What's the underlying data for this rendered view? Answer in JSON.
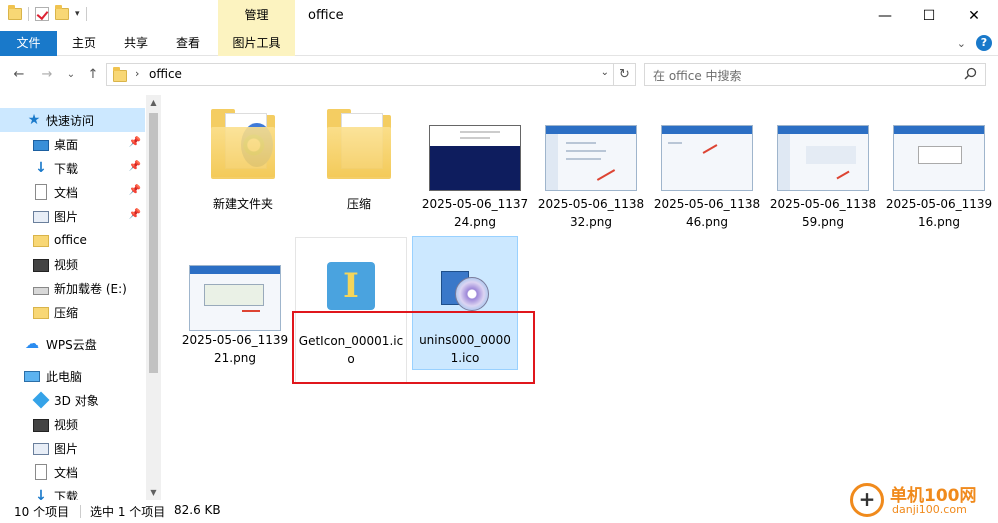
{
  "window": {
    "title": "office",
    "context_tab_group": "管理",
    "controls": [
      "—",
      "☐",
      "✕"
    ]
  },
  "ribbon": {
    "tabs": [
      "文件",
      "主页",
      "共享",
      "查看",
      "图片工具"
    ]
  },
  "address_bar": {
    "path": "office",
    "search_placeholder": "在 office 中搜索"
  },
  "nav_pane": {
    "items": [
      {
        "label": "快速访问",
        "icon": "star-icon"
      },
      {
        "label": "桌面",
        "icon": "desktop-icon"
      },
      {
        "label": "下载",
        "icon": "download-icon"
      },
      {
        "label": "文档",
        "icon": "document-icon"
      },
      {
        "label": "图片",
        "icon": "picture-icon"
      },
      {
        "label": "office",
        "icon": "folder-icon"
      },
      {
        "label": "视频",
        "icon": "video-icon"
      },
      {
        "label": "新加载卷 (E:)",
        "icon": "drive-icon"
      },
      {
        "label": "压缩",
        "icon": "folder-icon"
      },
      {
        "label": "WPS云盘",
        "icon": "cloud-icon"
      },
      {
        "label": "此电脑",
        "icon": "computer-icon"
      },
      {
        "label": "3D 对象",
        "icon": "3d-objects-icon"
      },
      {
        "label": "视频",
        "icon": "video-icon"
      },
      {
        "label": "图片",
        "icon": "picture-icon"
      },
      {
        "label": "文档",
        "icon": "document-icon"
      },
      {
        "label": "下载",
        "icon": "download-icon"
      }
    ]
  },
  "files": [
    {
      "name": "新建文件夹",
      "type": "folder"
    },
    {
      "name": "压缩",
      "type": "folder"
    },
    {
      "name": "2025-05-06_113724.png",
      "type": "image"
    },
    {
      "name": "2025-05-06_113832.png",
      "type": "image"
    },
    {
      "name": "2025-05-06_113846.png",
      "type": "image"
    },
    {
      "name": "2025-05-06_113859.png",
      "type": "image"
    },
    {
      "name": "2025-05-06_113916.png",
      "type": "image"
    },
    {
      "name": "2025-05-06_113921.png",
      "type": "image"
    },
    {
      "name": "GetIcon_00001.ico",
      "type": "ico"
    },
    {
      "name": "unins000_00001.ico",
      "type": "ico",
      "selected": true
    }
  ],
  "status": {
    "count": "10 个项目",
    "selection": "选中 1 个项目",
    "size": "82.6 KB"
  },
  "watermark": {
    "site": "单机100网",
    "domain": "danji100.com"
  },
  "colors": {
    "accent": "#1979ca",
    "context_tab": "#fcf3c0",
    "selection": "#cce8ff",
    "highlight_box": "#e0161c",
    "watermark": "#f08a1c"
  }
}
